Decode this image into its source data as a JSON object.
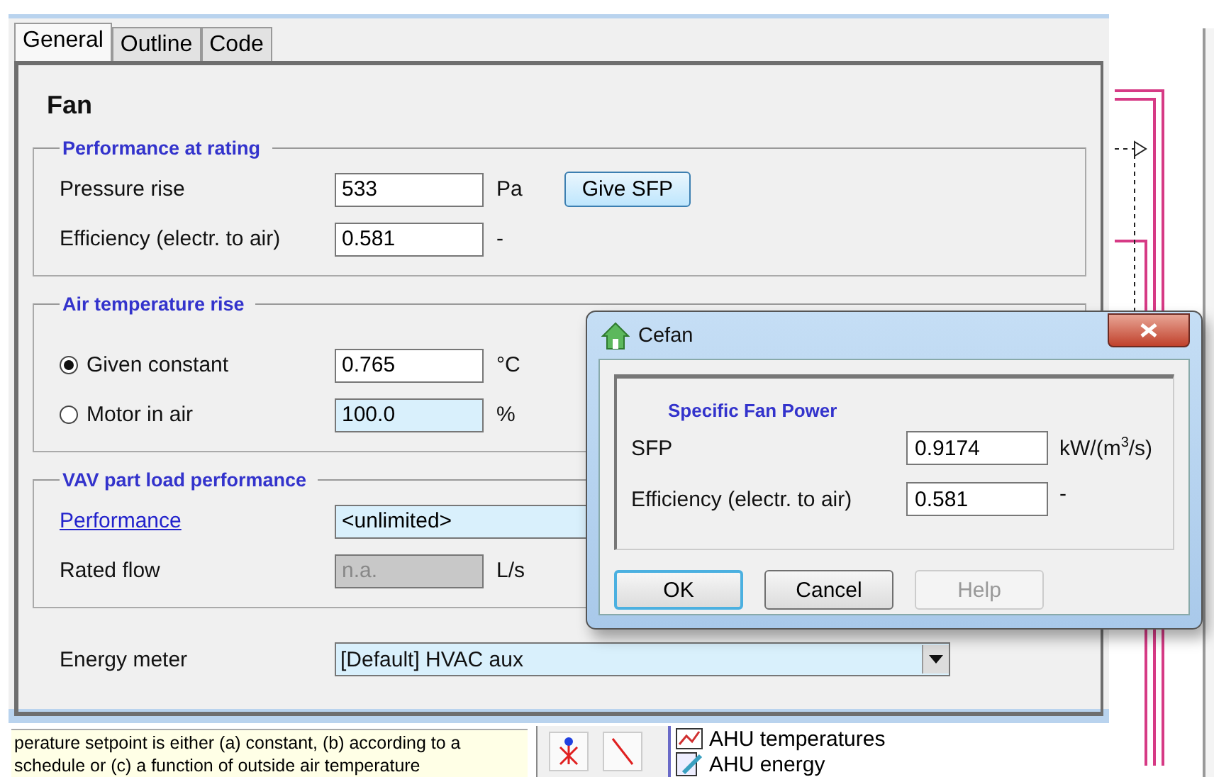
{
  "main_window": {
    "tabs": [
      {
        "label": "General",
        "selected": true
      },
      {
        "label": "Outline",
        "selected": false
      },
      {
        "label": "Code",
        "selected": false
      }
    ],
    "heading": "Fan",
    "groups": [
      {
        "title": "Performance at rating",
        "rows": [
          {
            "kind": "field",
            "label": "Pressure rise",
            "value": "533",
            "highlighted": false,
            "disabled": false,
            "unit": "Pa",
            "button": "Give SFP"
          },
          {
            "kind": "field",
            "label": "Efficiency (electr. to air)",
            "value": "0.581",
            "highlighted": false,
            "disabled": false,
            "unit": "-"
          }
        ]
      },
      {
        "title": "Air temperature rise",
        "rows": [
          {
            "kind": "radio",
            "label": "Given constant",
            "selected": true,
            "value": "0.765",
            "highlighted": false,
            "disabled": false,
            "unit": "°C"
          },
          {
            "kind": "radio",
            "label": "Motor in air",
            "selected": false,
            "value": "100.0",
            "highlighted": true,
            "disabled": false,
            "unit": "%"
          }
        ]
      },
      {
        "title": "VAV part load performance",
        "rows": [
          {
            "kind": "link",
            "label": "Performance",
            "value": "<unlimited>",
            "highlighted": true,
            "disabled": false
          },
          {
            "kind": "field",
            "label": "Rated flow",
            "value": "n.a.",
            "highlighted": false,
            "disabled": true,
            "unit": "L/s"
          }
        ]
      }
    ],
    "energy_meter": {
      "label": "Energy meter",
      "value": "[Default] HVAC aux"
    }
  },
  "help_text": "perature setpoint is either (a) constant, (b) according to a schedule or (c) a function of outside air temperature",
  "tree_items": [
    {
      "label": "AHU temperatures"
    },
    {
      "label": "AHU energy"
    }
  ],
  "dialog": {
    "title": "Cefan",
    "group_title": "Specific Fan Power",
    "rows": [
      {
        "label": "SFP",
        "value": "0.9174",
        "unit": "kW/(m$^{3}$/s)"
      },
      {
        "label": "Efficiency (electr. to air)",
        "value": "0.581",
        "unit": "-"
      }
    ],
    "buttons": [
      {
        "label": "OK",
        "default": true,
        "disabled": false
      },
      {
        "label": "Cancel",
        "default": false,
        "disabled": false
      },
      {
        "label": "Help",
        "default": false,
        "disabled": true
      }
    ]
  }
}
